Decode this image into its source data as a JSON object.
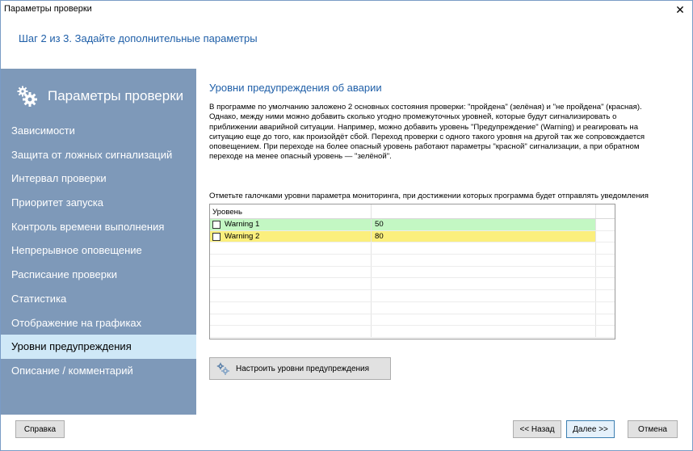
{
  "window": {
    "title": "Параметры проверки",
    "close_symbol": "✕"
  },
  "step_title": "Шаг 2 из 3. Задайте дополнительные параметры",
  "sidebar": {
    "header": "Параметры проверки",
    "header_icon": "gears-icon",
    "items": [
      {
        "label": "Зависимости",
        "active": false
      },
      {
        "label": "Защита от ложных сигнализаций",
        "active": false
      },
      {
        "label": "Интервал проверки",
        "active": false
      },
      {
        "label": "Приоритет запуска",
        "active": false
      },
      {
        "label": "Контроль времени выполнения",
        "active": false
      },
      {
        "label": "Непрерывное оповещение",
        "active": false
      },
      {
        "label": "Расписание проверки",
        "active": false
      },
      {
        "label": "Статистика",
        "active": false
      },
      {
        "label": "Отображение на графиках",
        "active": false
      },
      {
        "label": "Уровни предупреждения",
        "active": true
      },
      {
        "label": "Описание / комментарий",
        "active": false
      }
    ]
  },
  "content": {
    "heading": "Уровни предупреждения об аварии",
    "description": "В программе по умолчанию заложено 2 основных состояния проверки: \"пройдена\" (зелёная) и \"не пройдена\" (красная). Однако, между ними можно добавить сколько угодно промежуточных уровней, которые будут сигнализировать о приближении аварийной ситуации. Например, можно добавить уровень \"Предупреждение\" (Warning) и реагировать на ситуацию еще до того, как произойдёт сбой. Переход проверки с одного такого уровня на другой так же сопровождается оповещением. При переходе на более опасный уровень работают параметры \"красной\" сигнализации, а при обратном переходе на менее опасный уровень — \"зелёной\".",
    "hint": "Отметьте галочками уровни параметра мониторинга, при достижении которых программа будет отправлять уведомления"
  },
  "grid": {
    "column_header": "Уровень",
    "rows": [
      {
        "name": "Warning 1",
        "value": "50",
        "checked": false,
        "color": "#c3f7c3"
      },
      {
        "name": "Warning 2",
        "value": "80",
        "checked": false,
        "color": "#fbef7d"
      }
    ]
  },
  "buttons": {
    "configure_levels": "Настроить уровни предупреждения",
    "help": "Справка",
    "back": "<< Назад",
    "next": "Далее >>",
    "cancel": "Отмена"
  },
  "colors": {
    "accent_text": "#1f5fa8",
    "sidebar_bg": "#7e99b9",
    "sidebar_active_bg": "#cfe8f7"
  }
}
